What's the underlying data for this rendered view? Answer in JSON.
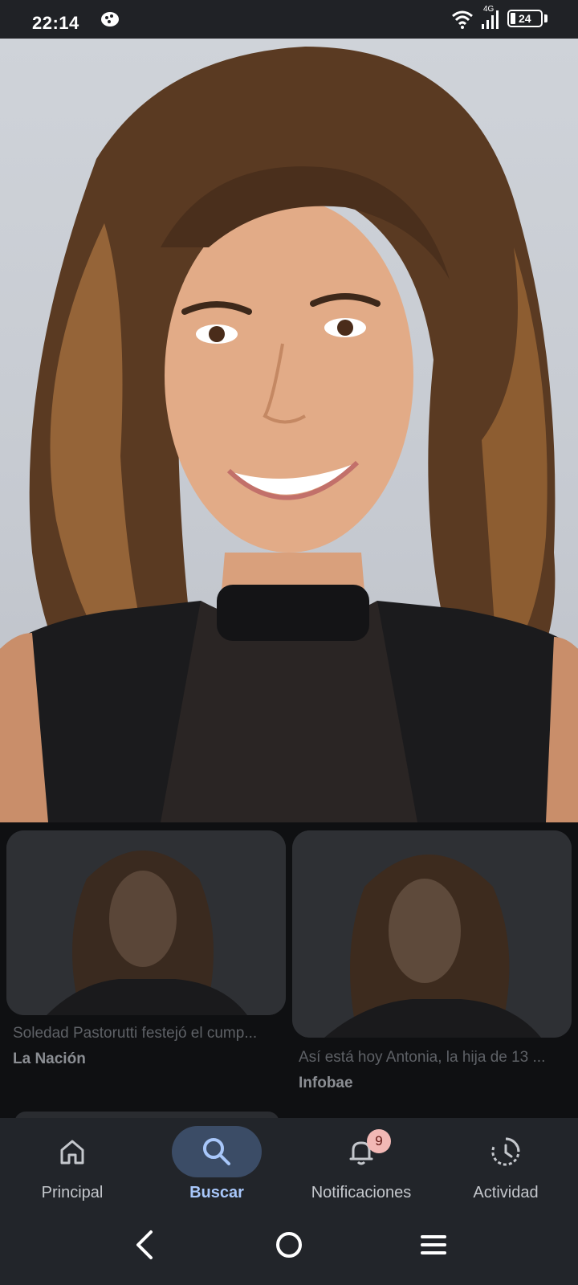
{
  "status_bar": {
    "time": "22:14",
    "network_type": "4G",
    "battery_level": "24",
    "icons": [
      "app-notification-icon",
      "wifi-icon",
      "signal-icon",
      "battery-icon"
    ]
  },
  "hero_image": {
    "description_icon": "portrait-photo"
  },
  "results": [
    {
      "caption": "Soledad Pastorutti festejó el cump...",
      "source": "La Nación"
    },
    {
      "caption": "Así está hoy Antonia, la hija de 13 ...",
      "source": "Infobae"
    }
  ],
  "bottom_nav": {
    "items": [
      {
        "label": "Principal",
        "icon": "home-icon"
      },
      {
        "label": "Buscar",
        "icon": "search-icon",
        "active": true
      },
      {
        "label": "Notificaciones",
        "icon": "bell-icon",
        "badge": "9"
      },
      {
        "label": "Actividad",
        "icon": "history-icon"
      }
    ]
  },
  "colors": {
    "active_nav_bg": "#3b4c66",
    "active_nav_text": "#a8c7fa",
    "badge_bg": "#f2b8b5",
    "surface": "#22252a"
  }
}
